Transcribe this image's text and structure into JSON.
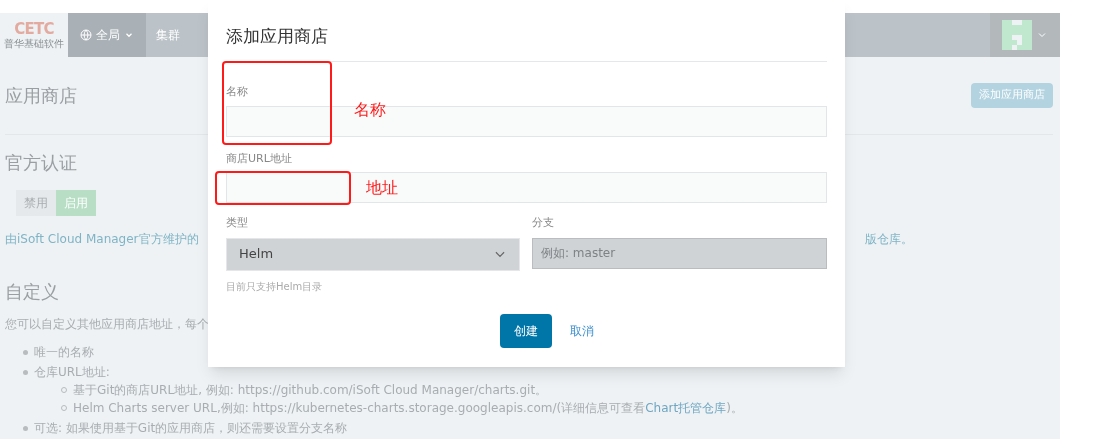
{
  "header": {
    "logo_text": "CETC",
    "logo_subtitle": "普华基础软件",
    "scope": "全局",
    "nav": [
      "集群"
    ]
  },
  "page": {
    "title": "应用商店",
    "add_button": "添加应用商店"
  },
  "official": {
    "heading": "官方认证",
    "toggle": [
      {
        "label": "禁用",
        "selected": false
      },
      {
        "label": "启用",
        "selected": true
      }
    ],
    "description": "由iSoft Cloud Manager官方维护的",
    "tail_link": "版仓库",
    "tail": "。"
  },
  "custom": {
    "heading": "自定义",
    "intro": "您可以自定义其他应用商店地址，每个",
    "items": [
      {
        "text": "唯一的名称"
      },
      {
        "text": "仓库URL地址:",
        "children": [
          {
            "text": "基于Git的商店URL地址, 例如: https://github.com/iSoft Cloud Manager/charts.git。"
          },
          {
            "text": "Helm Charts server URL,例如: https://kubernetes-charts.storage.googleapis.com/(详细信息可查看",
            "link": "Chart托管仓库",
            "after": ")。"
          }
        ]
      },
      {
        "text": "可选: 如果使用基于Git的应用商店，则还需要设置分支名称"
      }
    ]
  },
  "modal": {
    "title": "添加应用商店",
    "name_label": "名称",
    "url_label": "商店URL地址",
    "type_label": "类型",
    "type_value": "Helm",
    "type_help": "目前只支持Helm目录",
    "branch_label": "分支",
    "branch_placeholder": "例如: master",
    "create_button": "创建",
    "cancel_button": "取消"
  },
  "annotations": [
    {
      "label": "名称"
    },
    {
      "label": "地址"
    }
  ]
}
